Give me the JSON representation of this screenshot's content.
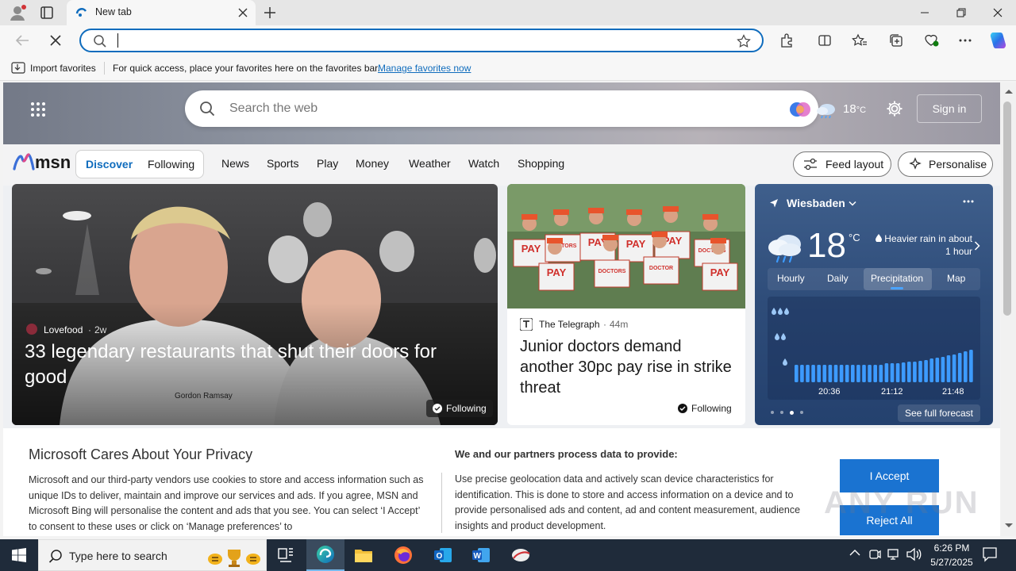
{
  "browser": {
    "tab_title": "New tab",
    "omnibox_value": "",
    "favbar": {
      "import_label": "Import favorites",
      "message": "For quick access, place your favorites here on the favorites bar.",
      "manage_link": "Manage favorites now"
    }
  },
  "msn": {
    "search_placeholder": "Search the web",
    "weather_temp_short": "18",
    "weather_unit_short": "°C",
    "signin_label": "Sign in",
    "brand": "msn",
    "toggle": [
      "Discover",
      "Following"
    ],
    "nav": [
      "News",
      "Sports",
      "Play",
      "Money",
      "Weather",
      "Watch",
      "Shopping"
    ],
    "feed_layout_label": "Feed layout",
    "personalise_label": "Personalise"
  },
  "cards": {
    "main": {
      "source": "Lovefood",
      "age": "2w",
      "headline": "33 legendary restaurants that shut their doors for good",
      "following_label": "Following"
    },
    "second": {
      "source": "The Telegraph",
      "age": "44m",
      "headline": "Junior doctors demand another 30pc pay rise in strike threat",
      "following_label": "Following",
      "placards": [
        "PAY",
        "DOCTORS",
        "PAY",
        "PAY",
        "PAY",
        "DOCTORS",
        "PAY",
        "DOCTORS",
        "DOCTOR",
        "PAY"
      ]
    },
    "weather": {
      "location": "Wiesbaden",
      "temperature": "18",
      "unit": "°C",
      "summary": "Heavier rain in about 1 hour",
      "tabs": [
        "Hourly",
        "Daily",
        "Precipitation",
        "Map"
      ],
      "active_tab": "Precipitation",
      "times": [
        "20:36",
        "21:12",
        "21:48"
      ],
      "see_full": "See full forecast",
      "precip_levels": [
        0.22,
        0.22,
        0.22,
        0.22,
        0.22,
        0.22,
        0.22,
        0.22,
        0.22,
        0.22,
        0.22,
        0.22,
        0.22,
        0.22,
        0.22,
        0.22,
        0.24,
        0.24,
        0.24,
        0.25,
        0.26,
        0.26,
        0.27,
        0.28,
        0.3,
        0.31,
        0.32,
        0.34,
        0.35,
        0.37,
        0.39,
        0.41
      ]
    }
  },
  "privacy": {
    "title": "Microsoft Cares About Your Privacy",
    "body": "Microsoft and our third-party vendors use cookies to store and access information such as unique IDs to deliver, maintain and improve our services and ads. If you agree, MSN and Microsoft Bing will personalise the content and ads that you see. You can select ‘I Accept’ to consent to these uses or click on ‘Manage preferences’ to",
    "partners_title": "We and our partners process data to provide:",
    "partners_body": "Use precise geolocation data and actively scan device characteristics for identification. This is done to store and access information on a device and to provide personalised ads and content, ad and content measurement, audience insights and product development.",
    "accept_label": "I Accept",
    "reject_label": "Reject All"
  },
  "taskbar": {
    "search_placeholder": "Type here to search",
    "time": "6:26 PM",
    "date": "5/27/2025"
  },
  "watermark": "ANY RUN",
  "colors": {
    "accent": "#0f6cbd",
    "taskbar": "#1f2b3a",
    "accept": "#1a73d1"
  }
}
